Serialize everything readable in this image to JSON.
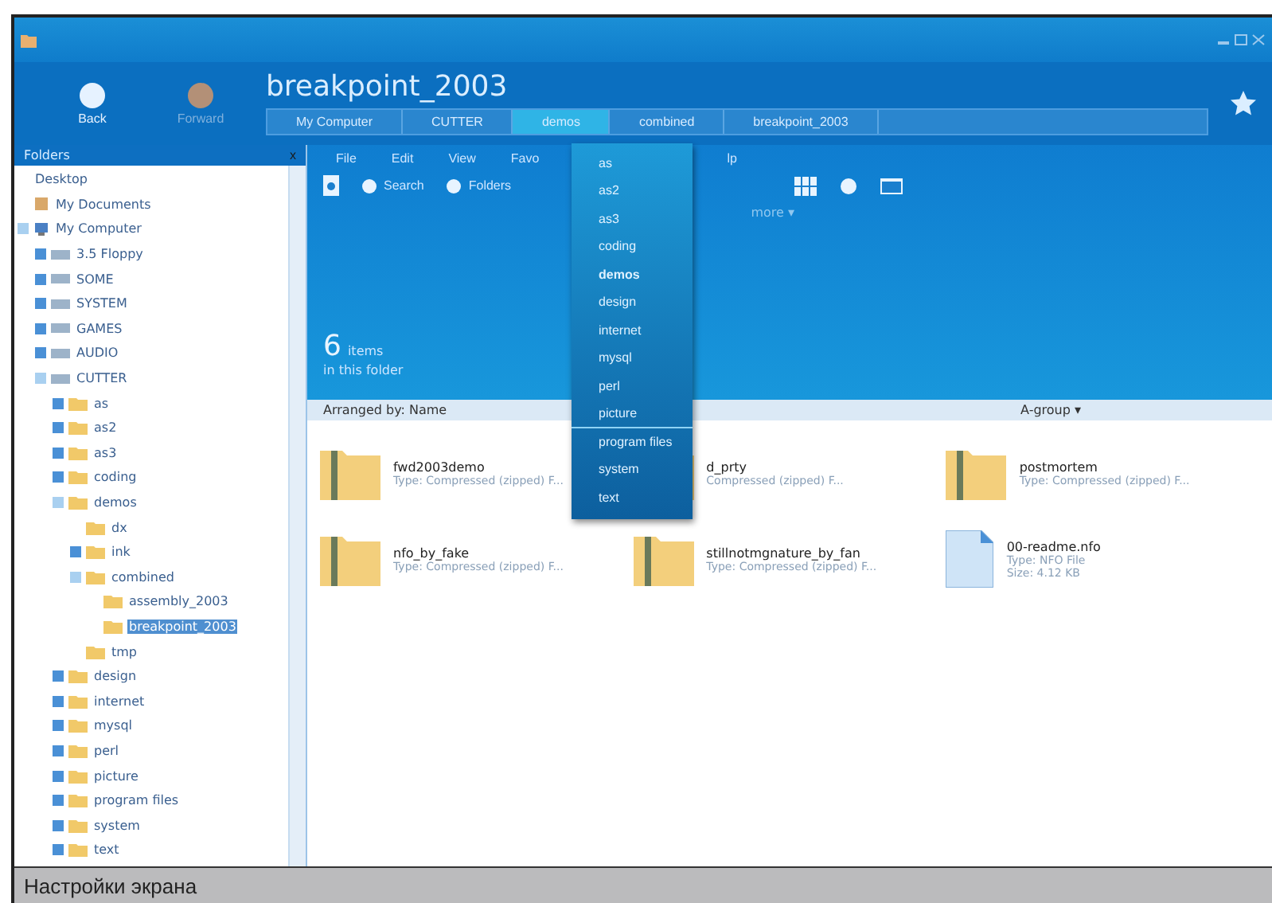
{
  "window": {
    "title": "breakpoint_2003"
  },
  "nav": [
    {
      "label": "Back",
      "disabled": false
    },
    {
      "label": "Forward",
      "disabled": true
    }
  ],
  "breadcrumb": [
    {
      "label": "My Computer",
      "selected": false
    },
    {
      "label": "CUTTER",
      "selected": false
    },
    {
      "label": "demos",
      "selected": true
    },
    {
      "label": "combined",
      "selected": false
    },
    {
      "label": "breakpoint_2003",
      "selected": false
    }
  ],
  "sidebar": {
    "title": "Folders",
    "close": "x",
    "tree": [
      {
        "label": "Desktop",
        "kind": "plain",
        "selected": false
      },
      {
        "label": "My Documents",
        "kind": "documents",
        "selected": false
      },
      {
        "label": "My Computer",
        "kind": "computer",
        "expanded": true,
        "selected": false,
        "children": [
          {
            "label": "3.5 Floppy",
            "kind": "drive",
            "expanded": false,
            "selected": false
          },
          {
            "label": "SOME",
            "kind": "drive",
            "expanded": false,
            "selected": false
          },
          {
            "label": "SYSTEM",
            "kind": "drive",
            "expanded": false,
            "selected": false
          },
          {
            "label": "GAMES",
            "kind": "drive",
            "expanded": false,
            "selected": false
          },
          {
            "label": "AUDIO",
            "kind": "drive",
            "expanded": false,
            "selected": false
          },
          {
            "label": "CUTTER",
            "kind": "drive",
            "expanded": true,
            "selected": false,
            "children": [
              {
                "label": "as",
                "kind": "folder",
                "expanded": false,
                "selected": false
              },
              {
                "label": "as2",
                "kind": "folder",
                "expanded": false,
                "selected": false
              },
              {
                "label": "as3",
                "kind": "folder",
                "expanded": false,
                "selected": false
              },
              {
                "label": "coding",
                "kind": "folder",
                "expanded": false,
                "selected": false
              },
              {
                "label": "demos",
                "kind": "folder",
                "expanded": true,
                "selected": false,
                "children": [
                  {
                    "label": "dx",
                    "kind": "folder",
                    "selected": false
                  },
                  {
                    "label": "ink",
                    "kind": "folder",
                    "expanded": false,
                    "selected": false
                  },
                  {
                    "label": "combined",
                    "kind": "folder",
                    "expanded": true,
                    "selected": false,
                    "children": [
                      {
                        "label": "assembly_2003",
                        "kind": "folder",
                        "selected": false
                      },
                      {
                        "label": "breakpoint_2003",
                        "kind": "folder",
                        "selected": true
                      }
                    ]
                  },
                  {
                    "label": "tmp",
                    "kind": "folder",
                    "selected": false
                  }
                ]
              },
              {
                "label": "design",
                "kind": "folder",
                "expanded": false,
                "selected": false
              },
              {
                "label": "internet",
                "kind": "folder",
                "expanded": false,
                "selected": false
              },
              {
                "label": "mysql",
                "kind": "folder",
                "expanded": false,
                "selected": false
              },
              {
                "label": "perl",
                "kind": "folder",
                "expanded": false,
                "selected": false
              },
              {
                "label": "picture",
                "kind": "folder",
                "expanded": false,
                "selected": false
              },
              {
                "label": "program files",
                "kind": "folder",
                "expanded": false,
                "selected": false
              },
              {
                "label": "system",
                "kind": "folder",
                "expanded": false,
                "selected": false
              },
              {
                "label": "text",
                "kind": "folder",
                "expanded": false,
                "selected": false
              }
            ]
          }
        ]
      }
    ]
  },
  "menu": [
    "File",
    "Edit",
    "View",
    "Favo",
    "lp"
  ],
  "toolbar": [
    {
      "label": "Search"
    },
    {
      "label": "Folders"
    }
  ],
  "more": "more ▾",
  "summary": {
    "count": "6",
    "unit": "items",
    "caption": "in this folder"
  },
  "arrange": {
    "label": "Arranged by: Name",
    "group": "A-group ▾"
  },
  "dropdown": [
    {
      "label": "as",
      "selected": false,
      "current": false
    },
    {
      "label": "as2",
      "selected": false,
      "current": false
    },
    {
      "label": "as3",
      "selected": false,
      "current": false
    },
    {
      "label": "coding",
      "selected": false,
      "current": false
    },
    {
      "label": "demos",
      "selected": false,
      "current": true
    },
    {
      "label": "design",
      "selected": false,
      "current": false
    },
    {
      "label": "internet",
      "selected": false,
      "current": false
    },
    {
      "label": "mysql",
      "selected": false,
      "current": false
    },
    {
      "label": "perl",
      "selected": false,
      "current": false
    },
    {
      "label": "picture",
      "selected": true,
      "current": false
    },
    {
      "label": "program files",
      "selected": false,
      "current": false
    },
    {
      "label": "system",
      "selected": false,
      "current": false
    },
    {
      "label": "text",
      "selected": false,
      "current": false
    }
  ],
  "files": [
    {
      "kind": "zip",
      "name": "fwd2003demo",
      "lines": [
        "Type: Compressed (zipped) F..."
      ]
    },
    {
      "kind": "zip",
      "name": "d_prty",
      "lines": [
        "Compressed (zipped) F..."
      ]
    },
    {
      "kind": "zip",
      "name": "postmortem",
      "lines": [
        "Type: Compressed (zipped) F..."
      ]
    },
    {
      "kind": "zip",
      "name": "nfo_by_fake",
      "lines": [
        "Type: Compressed (zipped) F..."
      ]
    },
    {
      "kind": "zip",
      "name": "stillnotmgnature_by_fan",
      "lines": [
        "Type: Compressed (zipped) F..."
      ]
    },
    {
      "kind": "doc",
      "name": "00-readme.nfo",
      "lines": [
        "Type: NFO File",
        "Size: 4.12 KB"
      ]
    }
  ],
  "caption": "Настройки экрана"
}
